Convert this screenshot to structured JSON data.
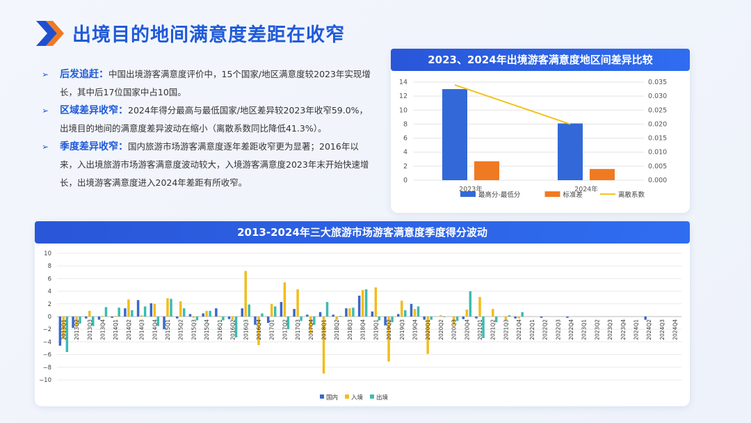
{
  "page_title": "出境目的地间满意度差距在收窄",
  "accent": "#1f5ad8",
  "bullets": [
    {
      "label": "后发追赶",
      "sep": "：",
      "text": "中国出境游客满意度评价中，15个国家/地区满意度较2023年实现增长，其中后17位国家中占10国。"
    },
    {
      "label": "区域差异收窄",
      "sep": "：",
      "text": "2024年得分最高与最低国家/地区差异较2023年收窄59.0%，出境目的地间的满意度差异波动在缩小（离散系数同比降低41.3%）。"
    },
    {
      "label": "季度差异收窄",
      "sep": "：",
      "text": "国内旅游市场游客满意度逐年差距收窄更为显著；2016年以来，入出境旅游市场游客满意度波动较大，入境游客满意度2023年末开始快速增长，出境游客满意度进入2024年差距有所收窄。"
    }
  ],
  "chart_data": [
    {
      "type": "bar",
      "title": "2023、2024年出境游客满意度地区间差异比较",
      "categories": [
        "2023年",
        "2024年"
      ],
      "series": [
        {
          "name": "最高分-最低分",
          "values": [
            13.0,
            8.1
          ],
          "axis": "left",
          "color": "#3268d8"
        },
        {
          "name": "标准差",
          "values": [
            2.7,
            1.6
          ],
          "axis": "left",
          "color": "#f07a22"
        },
        {
          "name": "离散系数",
          "values": [
            0.034,
            0.02
          ],
          "axis": "right",
          "type": "line",
          "color": "#f2c21b"
        }
      ],
      "ylim": [
        0,
        14
      ],
      "yticks": [
        "0",
        "2",
        "4",
        "6",
        "8",
        "10",
        "12",
        "14"
      ],
      "y2lim": [
        0,
        0.035
      ],
      "y2ticks": [
        "0.000",
        "0.005",
        "0.010",
        "0.015",
        "0.020",
        "0.025",
        "0.030",
        "0.035"
      ],
      "grid": true,
      "legend": "bottom"
    },
    {
      "type": "bar",
      "title": "2013-2024年三大旅游市场游客满意度季度得分波动",
      "categories": [
        "2013Q1",
        "2013Q2",
        "2013Q3",
        "2013Q4",
        "2014Q1",
        "2014Q2",
        "2014Q3",
        "2014Q4",
        "2015Q1",
        "2015Q2",
        "2015Q3",
        "2015Q4",
        "2016Q1",
        "2016Q2",
        "2016Q3",
        "2016Q4",
        "2017Q1",
        "2017Q2",
        "2017Q3",
        "2017Q4",
        "2018Q1",
        "2018Q2",
        "2018Q3",
        "2018Q4",
        "2019Q1",
        "2019Q2",
        "2019Q3",
        "2019Q4",
        "2020Q1",
        "2020Q2",
        "2020Q3",
        "2020Q4",
        "2021Q1",
        "2021Q2",
        "2021Q3",
        "2021Q4",
        "2022Q1",
        "2022Q2",
        "2022Q3",
        "2022Q4",
        "2023Q1",
        "2023Q2",
        "2023Q3",
        "2023Q4",
        "2024Q1",
        "2024Q2",
        "2024Q3",
        "2024Q4"
      ],
      "labels": [
        "2013Q1",
        "2013Q2",
        "2013Q3",
        "2013Q4",
        "2014Q1",
        "2014Q2",
        "2014Q3",
        "2014Q4",
        "2015Q1",
        "2015Q2",
        "2015Q3",
        "2015Q4",
        "2016Q1",
        "2016Q2",
        "2016Q3",
        "2016Q4",
        "2017Q1",
        "2017Q2",
        "2017Q3",
        "2017Q4",
        "2018Q1",
        "2018Q2",
        "2018Q3",
        "2018Q4",
        "2019Q1",
        "2019Q2",
        "2019Q3",
        "2019Q4",
        "2020Q1",
        "2020Q2",
        "2020Q3",
        "2020Q4",
        "2021Q1",
        "2021Q2",
        "2021Q3",
        "2021Q4",
        "2022Q1",
        "2022Q2",
        "2022Q3",
        "2022Q4",
        "2023Q1",
        "2023Q2",
        "2023Q3",
        "2023Q4",
        "2024Q1",
        "2024Q2",
        "2024Q3",
        "2024Q4"
      ],
      "series": [
        {
          "name": "国内",
          "color": "#3a68c8",
          "values": [
            -4.6,
            -1.8,
            -0.3,
            -0.5,
            -0.2,
            1.3,
            2.6,
            2.1,
            -2.0,
            -0.3,
            0.4,
            0.5,
            1.3,
            -0.4,
            1.3,
            -1.3,
            -1.0,
            2.3,
            1.2,
            0.3,
            0.7,
            0.3,
            1.3,
            3.3,
            0.8,
            -1.4,
            0.4,
            2.0,
            -0.5,
            0,
            0,
            -0.4,
            -0.3,
            0,
            0,
            -0.3,
            0,
            -0.2,
            0,
            -0.2,
            0,
            0,
            0,
            0,
            0,
            -0.5,
            0,
            0
          ]
        },
        {
          "name": "入境",
          "color": "#f2bc1b",
          "values": [
            -3.5,
            -1.5,
            0.9,
            0.1,
            0.1,
            2.7,
            0.2,
            2.0,
            2.9,
            2.4,
            -0.2,
            0.9,
            0.1,
            -0.5,
            7.2,
            -4.5,
            2.0,
            5.4,
            4.3,
            -2.7,
            -9.0,
            -0.5,
            1.3,
            4.2,
            4.6,
            -7.1,
            2.5,
            1.2,
            -5.9,
            0.2,
            -1.3,
            1.1,
            3.1,
            1.2,
            -0.5,
            -0.3,
            0,
            0,
            0,
            0,
            0,
            0,
            0,
            0,
            0,
            0,
            0,
            0
          ]
        },
        {
          "name": "出境",
          "color": "#3bbcb0",
          "values": [
            -5.6,
            -1.1,
            -1.5,
            1.5,
            1.4,
            1.0,
            1.6,
            -1.5,
            2.8,
            1.3,
            -0.6,
            0.9,
            -0.6,
            -3.3,
            1.9,
            0.5,
            1.6,
            -2.0,
            -0.7,
            -1.3,
            2.3,
            0.1,
            1.4,
            4.3,
            -0.6,
            -0.9,
            1.0,
            1.6,
            -0.5,
            -0.1,
            -0.7,
            4.0,
            -3.4,
            -0.9,
            0.2,
            0.7,
            0,
            0,
            0,
            0,
            0,
            0,
            0,
            0,
            0,
            0,
            0,
            0
          ]
        }
      ],
      "ylim": [
        -10,
        10
      ],
      "yticks": [
        "10",
        "8",
        "6",
        "4",
        "2",
        "0",
        "−2",
        "−4",
        "−6",
        "−8",
        "−10"
      ],
      "grid": true,
      "legend": "bottom"
    }
  ]
}
